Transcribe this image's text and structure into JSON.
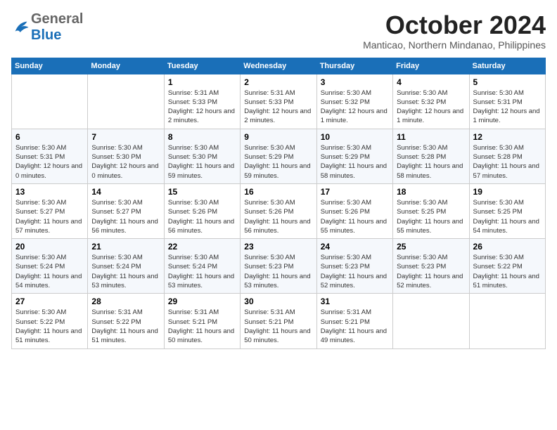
{
  "header": {
    "month": "October 2024",
    "location": "Manticao, Northern Mindanao, Philippines",
    "logo_general": "General",
    "logo_blue": "Blue"
  },
  "days_of_week": [
    "Sunday",
    "Monday",
    "Tuesday",
    "Wednesday",
    "Thursday",
    "Friday",
    "Saturday"
  ],
  "weeks": [
    [
      {
        "day": "",
        "info": ""
      },
      {
        "day": "",
        "info": ""
      },
      {
        "day": "1",
        "info": "Sunrise: 5:31 AM\nSunset: 5:33 PM\nDaylight: 12 hours and 2 minutes."
      },
      {
        "day": "2",
        "info": "Sunrise: 5:31 AM\nSunset: 5:33 PM\nDaylight: 12 hours and 2 minutes."
      },
      {
        "day": "3",
        "info": "Sunrise: 5:30 AM\nSunset: 5:32 PM\nDaylight: 12 hours and 1 minute."
      },
      {
        "day": "4",
        "info": "Sunrise: 5:30 AM\nSunset: 5:32 PM\nDaylight: 12 hours and 1 minute."
      },
      {
        "day": "5",
        "info": "Sunrise: 5:30 AM\nSunset: 5:31 PM\nDaylight: 12 hours and 1 minute."
      }
    ],
    [
      {
        "day": "6",
        "info": "Sunrise: 5:30 AM\nSunset: 5:31 PM\nDaylight: 12 hours and 0 minutes."
      },
      {
        "day": "7",
        "info": "Sunrise: 5:30 AM\nSunset: 5:30 PM\nDaylight: 12 hours and 0 minutes."
      },
      {
        "day": "8",
        "info": "Sunrise: 5:30 AM\nSunset: 5:30 PM\nDaylight: 11 hours and 59 minutes."
      },
      {
        "day": "9",
        "info": "Sunrise: 5:30 AM\nSunset: 5:29 PM\nDaylight: 11 hours and 59 minutes."
      },
      {
        "day": "10",
        "info": "Sunrise: 5:30 AM\nSunset: 5:29 PM\nDaylight: 11 hours and 58 minutes."
      },
      {
        "day": "11",
        "info": "Sunrise: 5:30 AM\nSunset: 5:28 PM\nDaylight: 11 hours and 58 minutes."
      },
      {
        "day": "12",
        "info": "Sunrise: 5:30 AM\nSunset: 5:28 PM\nDaylight: 11 hours and 57 minutes."
      }
    ],
    [
      {
        "day": "13",
        "info": "Sunrise: 5:30 AM\nSunset: 5:27 PM\nDaylight: 11 hours and 57 minutes."
      },
      {
        "day": "14",
        "info": "Sunrise: 5:30 AM\nSunset: 5:27 PM\nDaylight: 11 hours and 56 minutes."
      },
      {
        "day": "15",
        "info": "Sunrise: 5:30 AM\nSunset: 5:26 PM\nDaylight: 11 hours and 56 minutes."
      },
      {
        "day": "16",
        "info": "Sunrise: 5:30 AM\nSunset: 5:26 PM\nDaylight: 11 hours and 56 minutes."
      },
      {
        "day": "17",
        "info": "Sunrise: 5:30 AM\nSunset: 5:26 PM\nDaylight: 11 hours and 55 minutes."
      },
      {
        "day": "18",
        "info": "Sunrise: 5:30 AM\nSunset: 5:25 PM\nDaylight: 11 hours and 55 minutes."
      },
      {
        "day": "19",
        "info": "Sunrise: 5:30 AM\nSunset: 5:25 PM\nDaylight: 11 hours and 54 minutes."
      }
    ],
    [
      {
        "day": "20",
        "info": "Sunrise: 5:30 AM\nSunset: 5:24 PM\nDaylight: 11 hours and 54 minutes."
      },
      {
        "day": "21",
        "info": "Sunrise: 5:30 AM\nSunset: 5:24 PM\nDaylight: 11 hours and 53 minutes."
      },
      {
        "day": "22",
        "info": "Sunrise: 5:30 AM\nSunset: 5:24 PM\nDaylight: 11 hours and 53 minutes."
      },
      {
        "day": "23",
        "info": "Sunrise: 5:30 AM\nSunset: 5:23 PM\nDaylight: 11 hours and 53 minutes."
      },
      {
        "day": "24",
        "info": "Sunrise: 5:30 AM\nSunset: 5:23 PM\nDaylight: 11 hours and 52 minutes."
      },
      {
        "day": "25",
        "info": "Sunrise: 5:30 AM\nSunset: 5:23 PM\nDaylight: 11 hours and 52 minutes."
      },
      {
        "day": "26",
        "info": "Sunrise: 5:30 AM\nSunset: 5:22 PM\nDaylight: 11 hours and 51 minutes."
      }
    ],
    [
      {
        "day": "27",
        "info": "Sunrise: 5:30 AM\nSunset: 5:22 PM\nDaylight: 11 hours and 51 minutes."
      },
      {
        "day": "28",
        "info": "Sunrise: 5:31 AM\nSunset: 5:22 PM\nDaylight: 11 hours and 51 minutes."
      },
      {
        "day": "29",
        "info": "Sunrise: 5:31 AM\nSunset: 5:21 PM\nDaylight: 11 hours and 50 minutes."
      },
      {
        "day": "30",
        "info": "Sunrise: 5:31 AM\nSunset: 5:21 PM\nDaylight: 11 hours and 50 minutes."
      },
      {
        "day": "31",
        "info": "Sunrise: 5:31 AM\nSunset: 5:21 PM\nDaylight: 11 hours and 49 minutes."
      },
      {
        "day": "",
        "info": ""
      },
      {
        "day": "",
        "info": ""
      }
    ]
  ]
}
